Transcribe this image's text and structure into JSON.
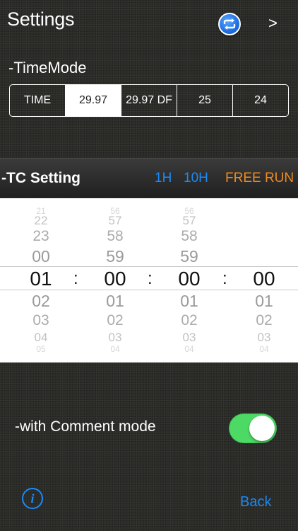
{
  "header": {
    "title": "Settings",
    "next_label": ">"
  },
  "time_mode": {
    "label": "-TimeMode",
    "options": [
      "TIME",
      "29.97",
      "29.97 DF",
      "25",
      "24"
    ],
    "selected": "29.97"
  },
  "tc_setting": {
    "label": "-TC Setting",
    "btn_1h": "1H",
    "btn_10h": "10H",
    "btn_free_run": "FREE RUN"
  },
  "picker": {
    "separator": ":",
    "wheels": [
      {
        "values": [
          "21",
          "22",
          "23",
          "00",
          "01",
          "02",
          "03",
          "04",
          "05"
        ],
        "selected": "01"
      },
      {
        "values": [
          "56",
          "57",
          "58",
          "59",
          "00",
          "01",
          "02",
          "03",
          "04"
        ],
        "selected": "00"
      },
      {
        "values": [
          "56",
          "57",
          "58",
          "59",
          "00",
          "01",
          "02",
          "03",
          "04"
        ],
        "selected": "00"
      },
      {
        "values": [
          "",
          "",
          "",
          "",
          "00",
          "01",
          "02",
          "03",
          "04"
        ],
        "selected": "00"
      }
    ]
  },
  "comment_mode": {
    "label": "-with Comment mode",
    "enabled": true
  },
  "footer": {
    "info_label": "i",
    "back_label": "Back"
  },
  "colors": {
    "accent_blue": "#1b8af5",
    "free_run_orange": "#f08a1e",
    "toggle_on": "#4cd964"
  }
}
